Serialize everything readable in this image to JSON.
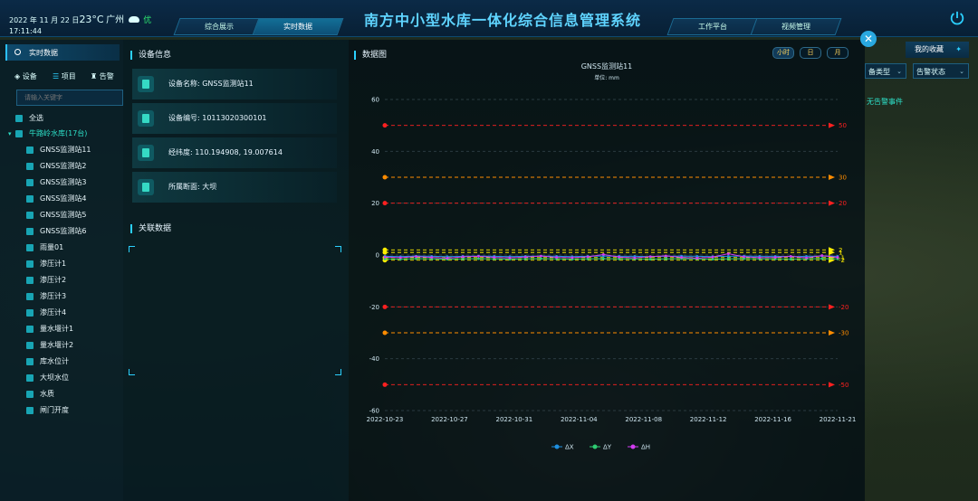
{
  "header": {
    "date": "2022 年 11 月 22 日",
    "temperature": "23°C",
    "city": "广州",
    "air_quality": "优",
    "time": "17:11:44",
    "title": "南方中小型水库一体化综合信息管理系统",
    "nav": [
      "综合展示",
      "实时数据",
      "工作平台",
      "视频管理"
    ],
    "active_nav": 1
  },
  "sidebar": {
    "tab_label": "实时数据",
    "filters": [
      "设备",
      "项目",
      "告警"
    ],
    "search_placeholder": "请输入关键字",
    "select_all": "全选",
    "group": "牛路岭水库(17台)",
    "items": [
      "GNSS监测站11",
      "GNSS监测站2",
      "GNSS监测站3",
      "GNSS监测站4",
      "GNSS监测站5",
      "GNSS监测站6",
      "雨量01",
      "渗压计1",
      "渗压计2",
      "渗压计3",
      "渗压计4",
      "量水堰计1",
      "量水堰计2",
      "库水位计",
      "大坝水位",
      "水质",
      "闸门开度"
    ]
  },
  "device_info": {
    "title": "设备信息",
    "rows": [
      "设备名称: GNSS监测站11",
      "设备编号: 10113020300101",
      "经纬度: 110.194908, 19.007614",
      "所属断面: 大坝"
    ]
  },
  "related": {
    "title": "关联数据"
  },
  "chart_panel": {
    "title": "数据图",
    "time_buttons": [
      "小时",
      "日",
      "月"
    ]
  },
  "chart_data": {
    "type": "line",
    "title": "GNSS监测站11",
    "subtitle": "单位: mm",
    "ylim": [
      -60,
      60
    ],
    "yticks": [
      60,
      40,
      20,
      0,
      -20,
      -40,
      -60
    ],
    "xticks": [
      "2022-10-23",
      "2022-10-27",
      "2022-10-31",
      "2022-11-04",
      "2022-11-08",
      "2022-11-12",
      "2022-11-16",
      "2022-11-21"
    ],
    "thresholds": [
      {
        "value": 50,
        "label": "50",
        "color": "#ff2020"
      },
      {
        "value": 30,
        "label": "30",
        "color": "#ff8c00"
      },
      {
        "value": 20,
        "label": "20",
        "color": "#ff2020"
      },
      {
        "value": 2,
        "label": "2",
        "color": "#ffee00"
      },
      {
        "value": 1,
        "label": "1",
        "color": "#ffee00"
      },
      {
        "value": -1,
        "label": "-1",
        "color": "#ffee00"
      },
      {
        "value": -2,
        "label": "-2",
        "color": "#ffee00"
      },
      {
        "value": -20,
        "label": "-20",
        "color": "#ff2020"
      },
      {
        "value": -30,
        "label": "-30",
        "color": "#ff8c00"
      },
      {
        "value": -50,
        "label": "-50",
        "color": "#ff2020"
      }
    ],
    "series": [
      {
        "name": "ΔX",
        "color": "#1e8fe0",
        "values": [
          -0.5,
          -0.6,
          -0.4,
          -0.5,
          -0.6,
          -0.5,
          -0.4,
          -0.5,
          -0.6,
          -0.5,
          -0.4,
          -0.5,
          -0.6,
          -0.5,
          -0.4,
          -0.5,
          -0.5,
          -0.6,
          -0.5,
          -0.4,
          -0.5,
          -0.6,
          -0.5,
          -0.4,
          -0.5,
          -0.5,
          -0.6,
          -0.5,
          -0.4,
          -0.5
        ]
      },
      {
        "name": "ΔY",
        "color": "#2ecc71",
        "values": [
          -1.5,
          -1.6,
          -1.4,
          -1.5,
          -1.6,
          -1.5,
          -1.4,
          -1.5,
          -1.6,
          -1.5,
          -1.4,
          -1.5,
          -1.6,
          -1.5,
          -1.4,
          -1.5,
          -1.5,
          -1.6,
          -1.5,
          -1.4,
          -1.5,
          -1.6,
          -1.5,
          -1.4,
          -1.5,
          -1.5,
          -1.6,
          -1.5,
          -1.4,
          -1.5
        ]
      },
      {
        "name": "ΔH",
        "color": "#d23cf0",
        "values": [
          -0.8,
          -1.0,
          -0.6,
          -0.9,
          -1.2,
          -0.7,
          -0.5,
          -0.9,
          -1.1,
          -0.8,
          -0.4,
          -0.9,
          -1.0,
          -0.7,
          0.2,
          -0.8,
          -1.1,
          -0.6,
          -0.3,
          -0.9,
          -1.2,
          -0.8,
          0.5,
          -0.7,
          -1.0,
          -0.9,
          -0.5,
          -1.1,
          -0.2,
          -0.9
        ]
      }
    ]
  },
  "right": {
    "fav_label": "我的收藏",
    "select1": "备类型",
    "select2": "告警状态",
    "no_alarm": "无告警事件"
  },
  "colors": {
    "accent": "#2bd0ff",
    "header_bg": "#0b2a47",
    "panel_bg": "#041822"
  }
}
